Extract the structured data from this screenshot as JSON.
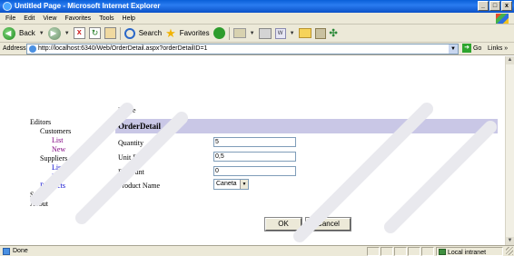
{
  "window": {
    "title": "Untitled Page - Microsoft Internet Explorer",
    "controls": [
      "_",
      "□",
      "x"
    ]
  },
  "menu": [
    "File",
    "Edit",
    "View",
    "Favorites",
    "Tools",
    "Help"
  ],
  "toolbar": {
    "back_label": "Back",
    "search_label": "Search",
    "favorites_label": "Favorites"
  },
  "address": {
    "label": "Address",
    "url": "http://localhost:6340/Web/OrderDetail.aspx?orderDetailID=1",
    "go_label": "Go",
    "links_label": "Links »"
  },
  "page": {
    "breadcrumb": "Home",
    "nav": [
      {
        "label": "Editors",
        "level": 1,
        "state": "text"
      },
      {
        "label": "Customers",
        "level": 2,
        "state": "text"
      },
      {
        "label": "List",
        "level": 3,
        "state": "visited"
      },
      {
        "label": "New",
        "level": 3,
        "state": "visited"
      },
      {
        "label": "Suppliers",
        "level": 2,
        "state": "text"
      },
      {
        "label": "List",
        "level": 3,
        "state": "link"
      },
      {
        "label": "New",
        "level": 3,
        "state": "link"
      },
      {
        "label": "Products",
        "level": 2,
        "state": "link"
      },
      {
        "label": "Setup",
        "level": 1,
        "state": "text"
      },
      {
        "label": "About",
        "level": 1,
        "state": "text"
      }
    ],
    "form": {
      "title": "OrderDetail",
      "fields": [
        {
          "label": "Quantity",
          "value": "5"
        },
        {
          "label": "Unit Price",
          "value": "0,5"
        },
        {
          "label": "Discount",
          "value": "0"
        }
      ],
      "product": {
        "label": "Product Name",
        "selected": "Caneta"
      },
      "ok_label": "OK",
      "cancel_label": "Cancel"
    },
    "header_color": "#c9c7e6"
  },
  "status": {
    "text": "Done",
    "zone": "Local intranet"
  }
}
